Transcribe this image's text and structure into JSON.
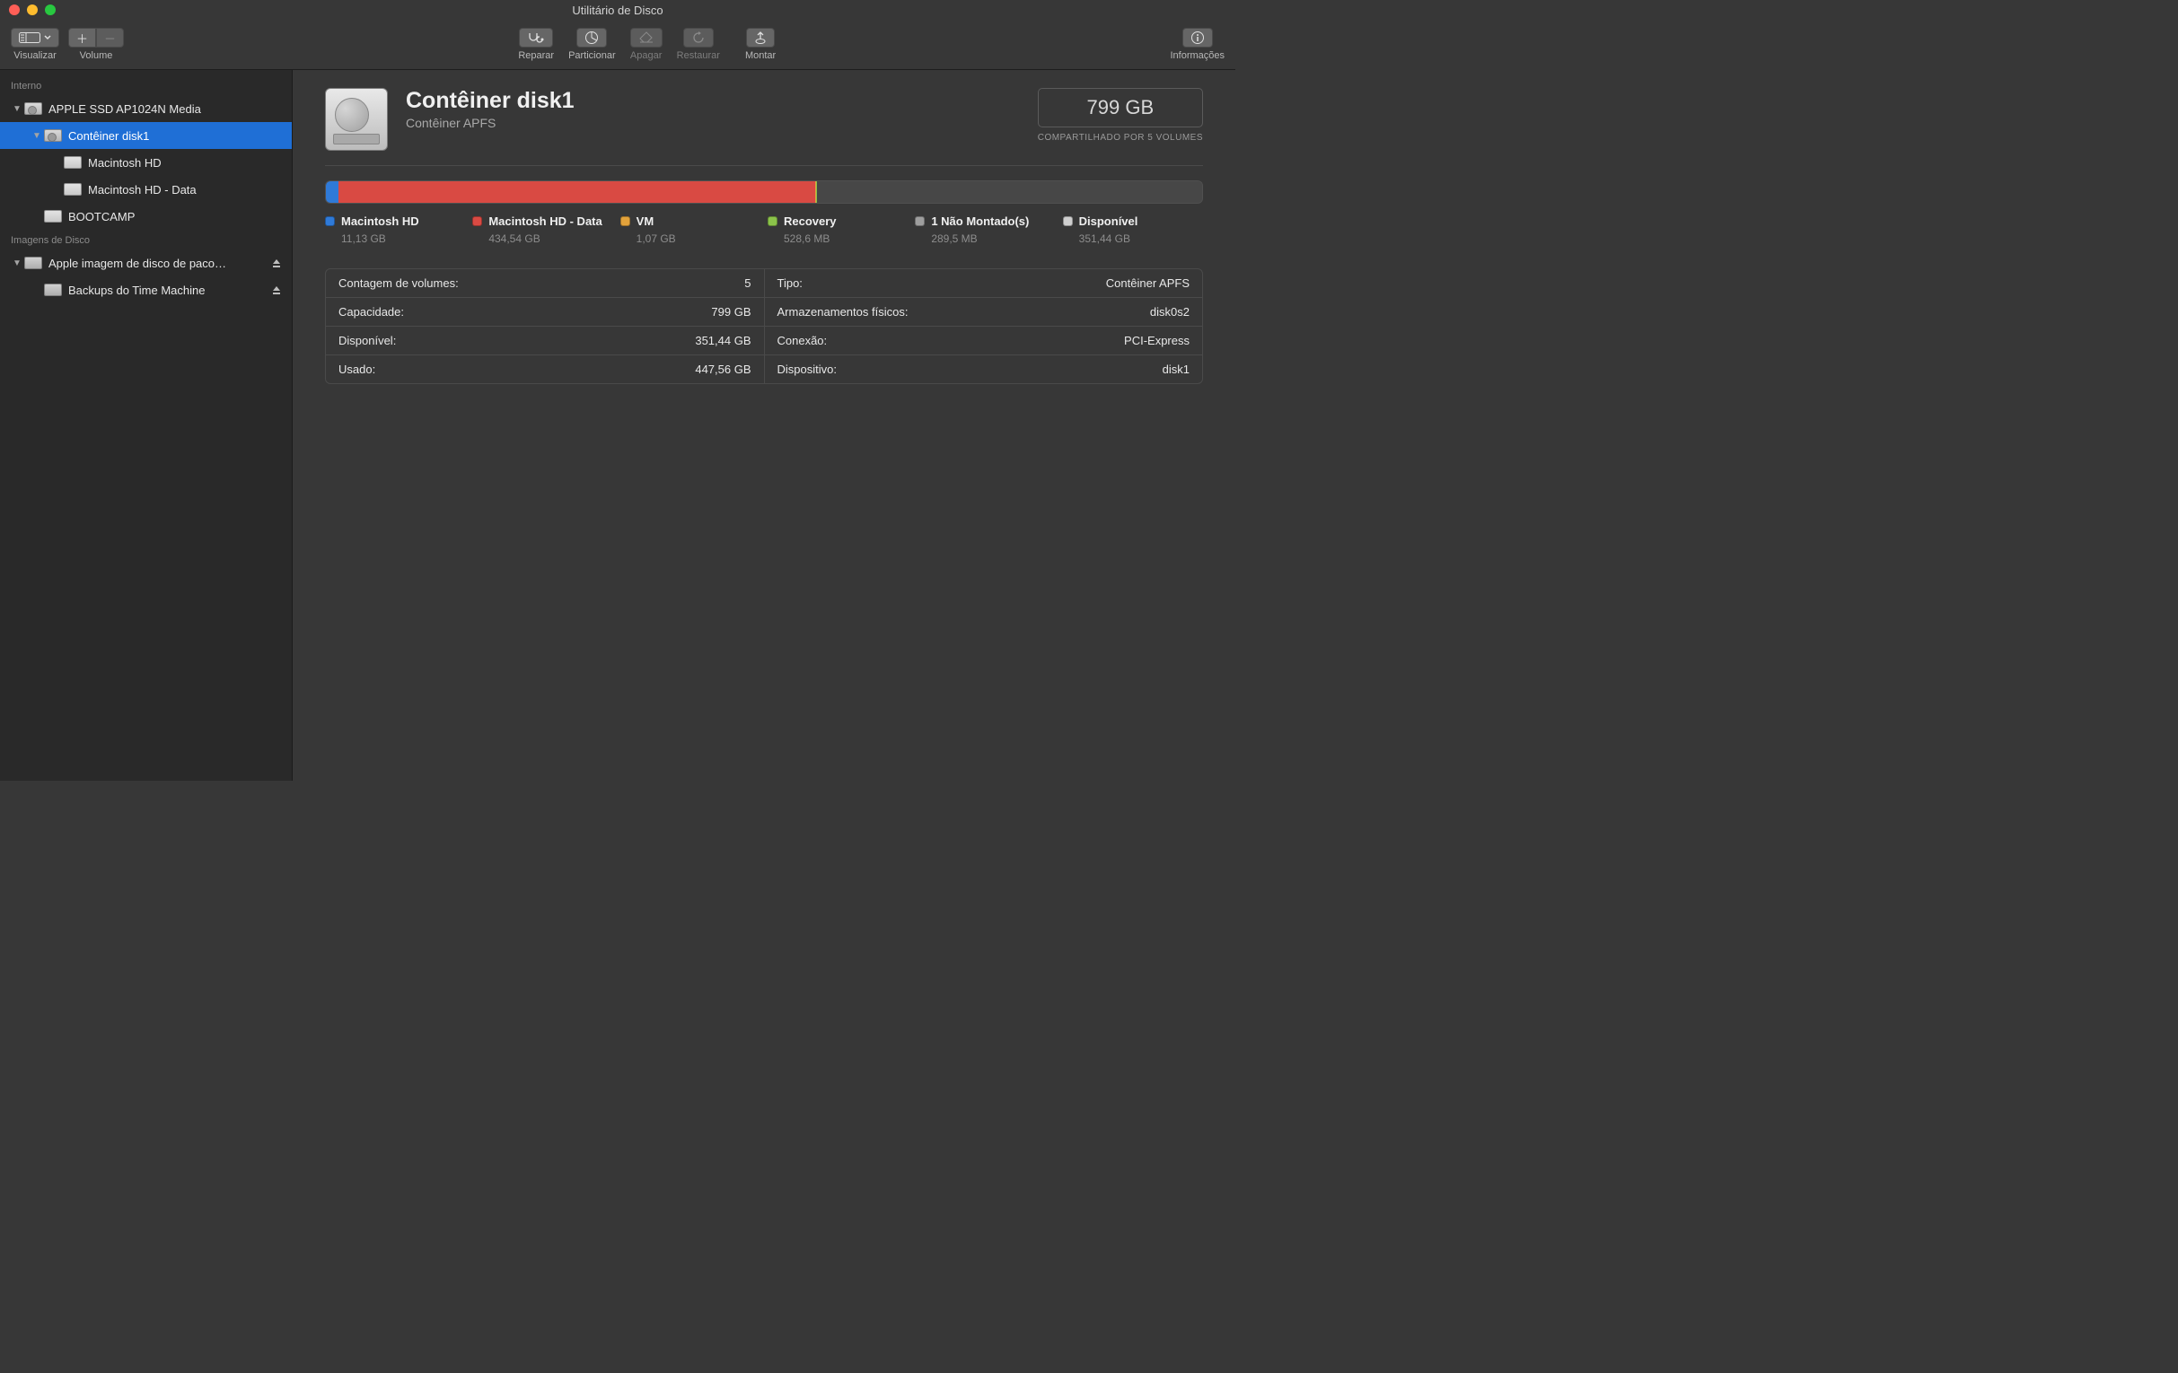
{
  "window": {
    "title": "Utilitário de Disco"
  },
  "toolbar": {
    "view_label": "Visualizar",
    "volume_label": "Volume",
    "repair_label": "Reparar",
    "partition_label": "Particionar",
    "erase_label": "Apagar",
    "restore_label": "Restaurar",
    "mount_label": "Montar",
    "info_label": "Informações"
  },
  "sidebar": {
    "sections": {
      "internal": "Interno",
      "disk_images": "Imagens de Disco"
    },
    "internal": [
      {
        "label": "APPLE SSD AP1024N Media",
        "indent": 0,
        "icon": "hdd",
        "disclosure": "down"
      },
      {
        "label": "Contêiner disk1",
        "indent": 1,
        "icon": "hdd",
        "disclosure": "down",
        "selected": true
      },
      {
        "label": "Macintosh HD",
        "indent": 2,
        "icon": "vol"
      },
      {
        "label": "Macintosh HD - Data",
        "indent": 2,
        "icon": "vol"
      },
      {
        "label": "BOOTCAMP",
        "indent": 1,
        "icon": "vol"
      }
    ],
    "images": [
      {
        "label": "Apple imagem de disco de paco…",
        "indent": 0,
        "icon": "dmg",
        "disclosure": "down",
        "eject": true
      },
      {
        "label": "Backups do Time Machine",
        "indent": 1,
        "icon": "dmg",
        "eject": true
      }
    ]
  },
  "main": {
    "title": "Contêiner disk1",
    "subtitle": "Contêiner APFS",
    "capacity": "799 GB",
    "capacity_note": "COMPARTILHADO POR 5 VOLUMES",
    "usage": [
      {
        "name": "Macintosh HD",
        "value": "11,13 GB",
        "color": "#2f7ad8",
        "pct": 1.4
      },
      {
        "name": "Macintosh HD - Data",
        "value": "434,54 GB",
        "color": "#d94a43",
        "pct": 54.4
      },
      {
        "name": "VM",
        "value": "1,07 GB",
        "color": "#e2a23b",
        "pct": 0.15
      },
      {
        "name": "Recovery",
        "value": "528,6 MB",
        "color": "#8bc34a",
        "pct": 0.07
      },
      {
        "name": "1 Não Montado(s)",
        "value": "289,5 MB",
        "color": "#9e9e9e",
        "pct": 0.04
      },
      {
        "name": "Disponível",
        "value": "351,44 GB",
        "color": "#cfcfcf",
        "pct": 43.94
      }
    ],
    "details_left": [
      {
        "k": "Contagem de volumes:",
        "v": "5"
      },
      {
        "k": "Capacidade:",
        "v": "799 GB"
      },
      {
        "k": "Disponível:",
        "v": "351,44 GB"
      },
      {
        "k": "Usado:",
        "v": "447,56 GB"
      }
    ],
    "details_right": [
      {
        "k": "Tipo:",
        "v": "Contêiner APFS"
      },
      {
        "k": "Armazenamentos físicos:",
        "v": "disk0s2"
      },
      {
        "k": "Conexão:",
        "v": "PCI-Express"
      },
      {
        "k": "Dispositivo:",
        "v": "disk1"
      }
    ]
  },
  "colors": {
    "selection": "#1f6fd6"
  }
}
